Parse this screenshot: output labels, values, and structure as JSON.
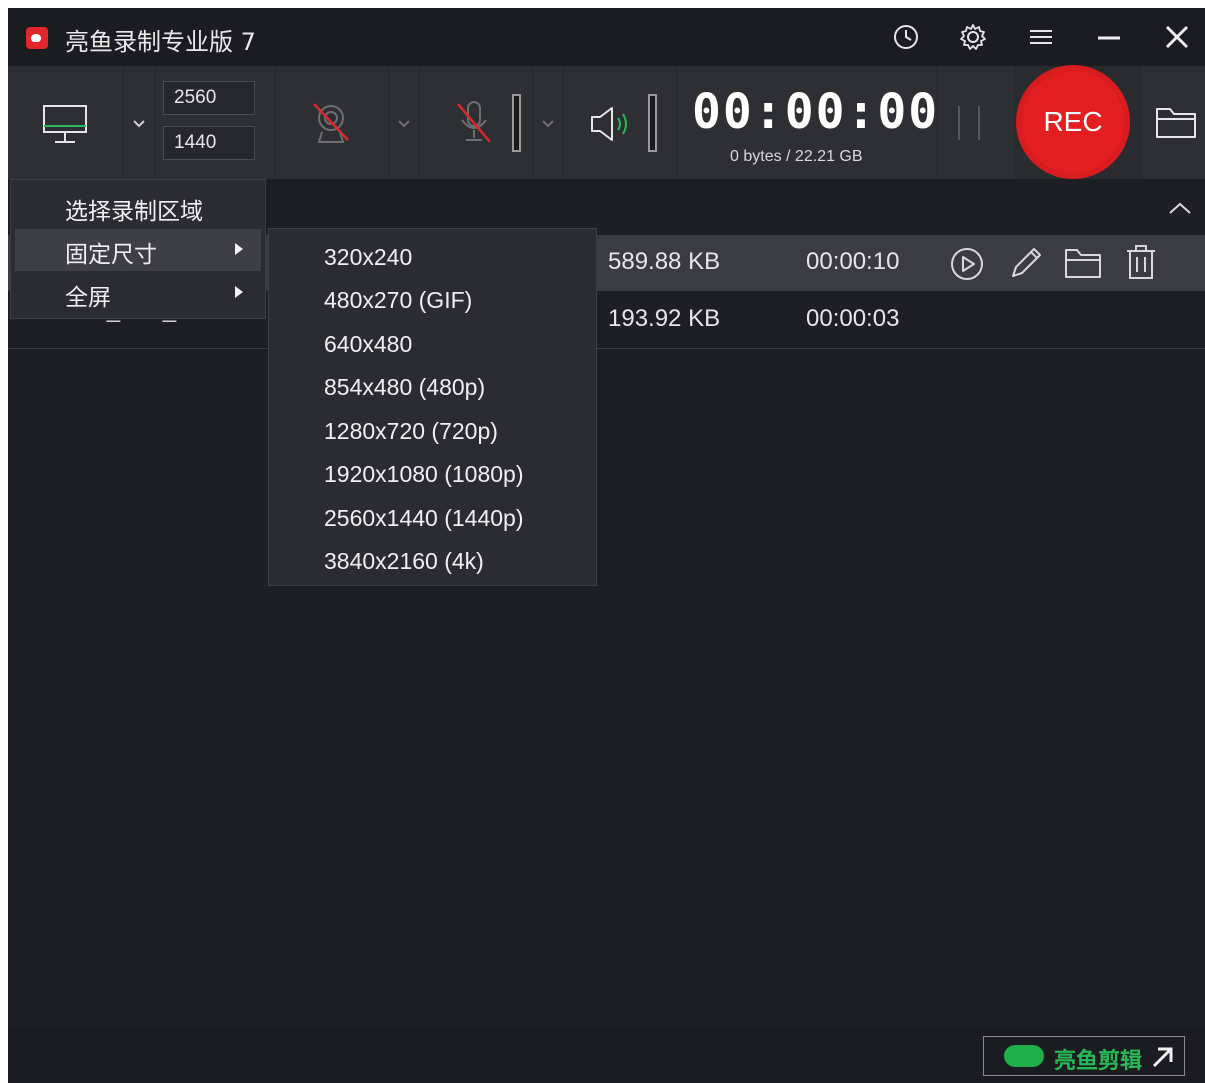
{
  "app": {
    "title": "亮鱼录制专业版 7"
  },
  "toolbar": {
    "width": "2560",
    "height": "1440",
    "timer": "00:00:00",
    "storage": "0 bytes / 22.21 GB",
    "rec_label": "REC"
  },
  "recordings": [
    {
      "name": "",
      "size": "589.88 KB",
      "duration": "00:00:10"
    },
    {
      "name": "LUXEA_Rec_2023-12",
      "size": "193.92 KB",
      "duration": "00:00:03"
    }
  ],
  "menu": {
    "items": [
      {
        "label": "选择录制区域",
        "submenu": false
      },
      {
        "label": "固定尺寸",
        "submenu": true
      },
      {
        "label": "全屏",
        "submenu": true
      }
    ]
  },
  "submenu": {
    "items": [
      "320x240",
      "480x270 (GIF)",
      "640x480",
      "854x480 (480p)",
      "1280x720 (720p)",
      "1920x1080 (1080p)",
      "2560x1440 (1440p)",
      "3840x2160 (4k)"
    ]
  },
  "footer": {
    "brand_label": "亮鱼剪辑"
  },
  "colors": {
    "accent_red": "#e41f22",
    "brand_green": "#27b857",
    "background": "#1e1f22"
  }
}
